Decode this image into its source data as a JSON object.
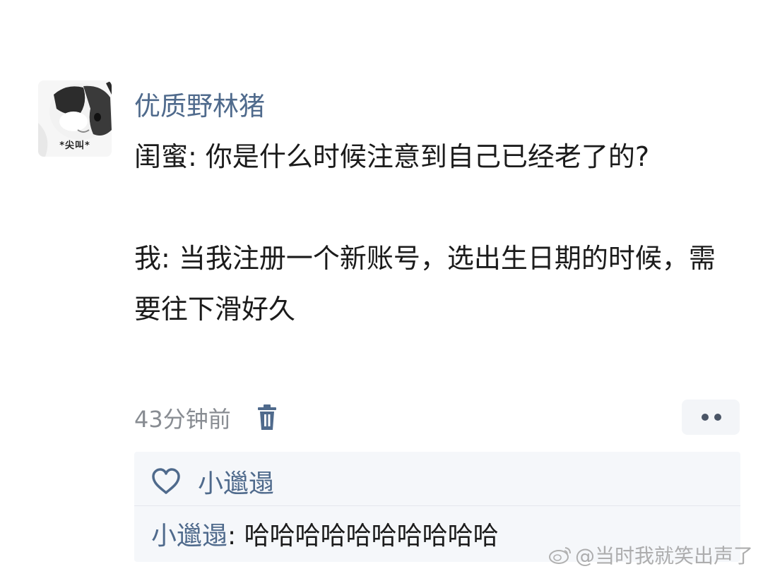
{
  "post": {
    "avatar_caption": "*尖叫*",
    "username": "优质野林猪",
    "paragraphs": [
      "闺蜜: 你是什么时候注意到自己已经老了的?",
      "我: 当我注册一个新账号，选出生日期的时候，需要往下滑好久"
    ],
    "timestamp": "43分钟前",
    "icons": {
      "delete": "trash-icon",
      "more": "more-dots-icon"
    }
  },
  "reply_section": {
    "liked_by": "小邋遢",
    "like_icon": "heart-outline-icon",
    "replies": [
      {
        "author": "小邋遢",
        "separator": ": ",
        "text": "哈哈哈哈哈哈哈哈哈哈"
      }
    ]
  },
  "watermark": {
    "text": "@当时我就笑出声了",
    "icon": "weibo-icon"
  },
  "colors": {
    "name_blue": "#4f6a8c",
    "text": "#1b1b1b",
    "muted": "#888c92",
    "panel_bg": "#f5f7fa"
  }
}
